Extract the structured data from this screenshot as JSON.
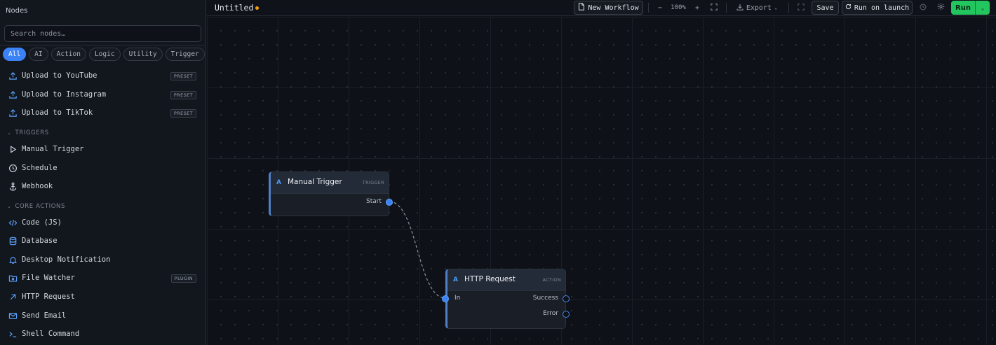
{
  "sidebar": {
    "title": "Nodes",
    "search_placeholder": "Search nodes…",
    "filters": [
      {
        "label": "All",
        "active": true
      },
      {
        "label": "AI",
        "active": false
      },
      {
        "label": "Action",
        "active": false
      },
      {
        "label": "Logic",
        "active": false
      },
      {
        "label": "Utility",
        "active": false
      },
      {
        "label": "Trigger",
        "active": false
      }
    ],
    "presets": [
      {
        "label": "Upload to YouTube",
        "icon": "upload-icon",
        "badge": "PRESET"
      },
      {
        "label": "Upload to Instagram",
        "icon": "upload-icon",
        "badge": "PRESET"
      },
      {
        "label": "Upload to TikTok",
        "icon": "upload-icon",
        "badge": "PRESET"
      }
    ],
    "triggers_section": "TRIGGERS",
    "triggers": [
      {
        "label": "Manual Trigger",
        "icon": "play-icon"
      },
      {
        "label": "Schedule",
        "icon": "clock-icon"
      },
      {
        "label": "Webhook",
        "icon": "anchor-icon"
      }
    ],
    "core_section": "CORE ACTIONS",
    "core_actions": [
      {
        "label": "Code (JS)",
        "icon": "code-icon"
      },
      {
        "label": "Database",
        "icon": "database-icon"
      },
      {
        "label": "Desktop Notification",
        "icon": "bell-icon"
      },
      {
        "label": "File Watcher",
        "icon": "folder-eye-icon",
        "badge": "PLUGIN"
      },
      {
        "label": "HTTP Request",
        "icon": "arrow-up-right-icon"
      },
      {
        "label": "Send Email",
        "icon": "mail-icon"
      },
      {
        "label": "Shell Command",
        "icon": "terminal-icon"
      }
    ]
  },
  "toolbar": {
    "workflow_title": "Untitled",
    "new_workflow": "New Workflow",
    "zoom": "100%",
    "export": "Export",
    "save": "Save",
    "run_on_launch": "Run on launch",
    "run": "Run"
  },
  "canvas": {
    "nodes": [
      {
        "id": "manual",
        "badge": "A",
        "title": "Manual Trigger",
        "type": "TRIGGER",
        "outputs": [
          "Start"
        ]
      },
      {
        "id": "http",
        "badge": "A",
        "title": "HTTP Request",
        "type": "ACTION",
        "inputs": [
          "In"
        ],
        "outputs": [
          "Success",
          "Error"
        ]
      }
    ]
  },
  "colors": {
    "accent": "#3b82f6",
    "run": "#22c55e",
    "dirty": "#f59e0b"
  }
}
